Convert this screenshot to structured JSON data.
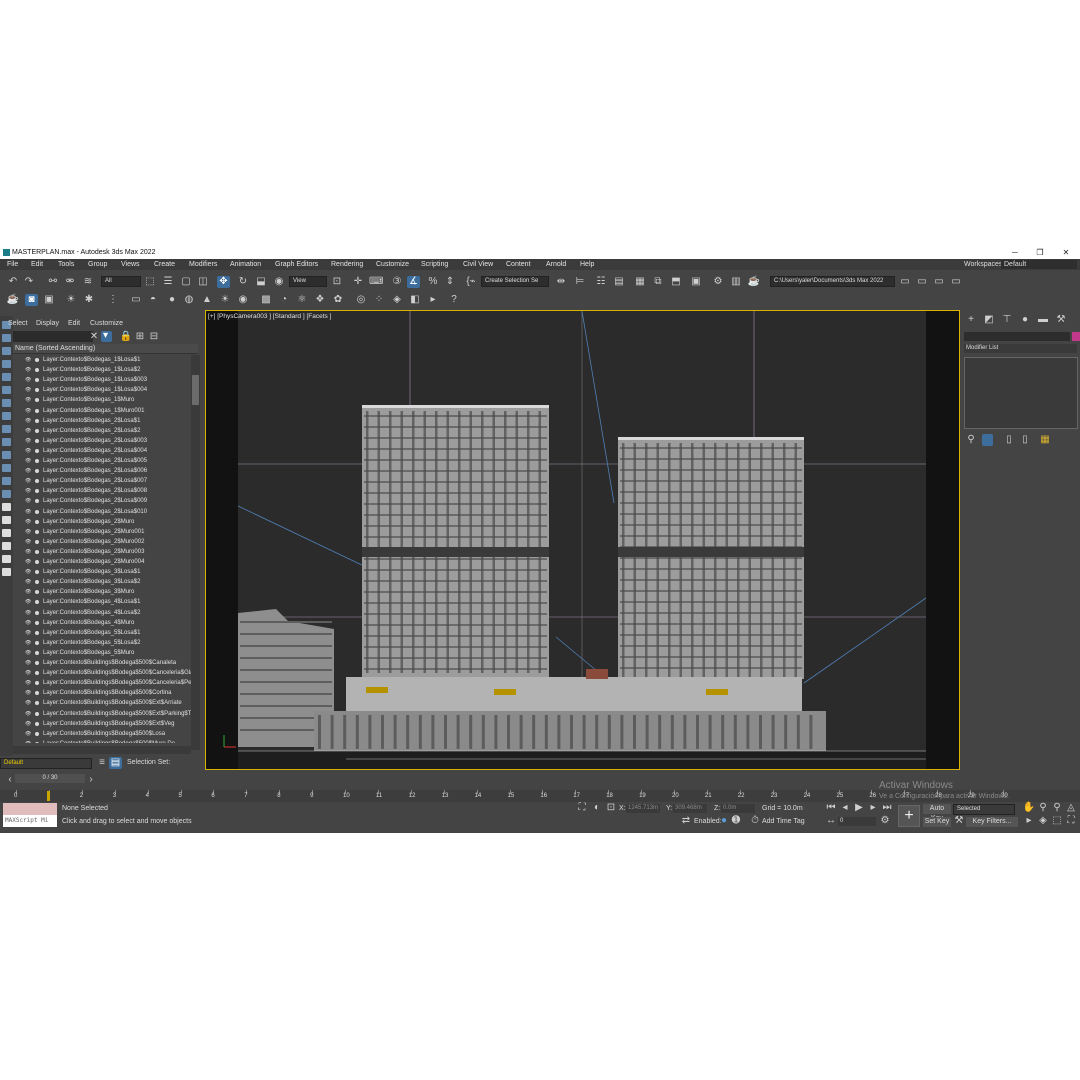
{
  "window": {
    "title": "MASTERPLAN.max - Autodesk 3ds Max 2022",
    "minimize": "─",
    "maximize": "❐",
    "close": "✕"
  },
  "menu": [
    "File",
    "Edit",
    "Tools",
    "Group",
    "Views",
    "Create",
    "Modifiers",
    "Animation",
    "Graph Editors",
    "Rendering",
    "Customize",
    "Scripting",
    "Civil View",
    "Content",
    "Arnold",
    "Help"
  ],
  "workspaces": {
    "label": "Workspaces:",
    "value": "Default"
  },
  "toolbar": {
    "filter": "All",
    "ref_coord": "View",
    "selection_set": "Create Selection Se",
    "project_path": "C:\\Users\\yaler\\Documents\\3ds Max 2022"
  },
  "scene_explorer": {
    "tabs": [
      "Select",
      "Display",
      "Edit",
      "Customize"
    ],
    "column_header": "Name (Sorted Ascending)",
    "rows": [
      "Layer:Contexto$Bodegas_1$Losa$1",
      "Layer:Contexto$Bodegas_1$Losa$2",
      "Layer:Contexto$Bodegas_1$Losa$003",
      "Layer:Contexto$Bodegas_1$Losa$004",
      "Layer:Contexto$Bodegas_1$Muro",
      "Layer:Contexto$Bodegas_1$Muro001",
      "Layer:Contexto$Bodegas_2$Losa$1",
      "Layer:Contexto$Bodegas_2$Losa$2",
      "Layer:Contexto$Bodegas_2$Losa$003",
      "Layer:Contexto$Bodegas_2$Losa$004",
      "Layer:Contexto$Bodegas_2$Losa$005",
      "Layer:Contexto$Bodegas_2$Losa$006",
      "Layer:Contexto$Bodegas_2$Losa$007",
      "Layer:Contexto$Bodegas_2$Losa$008",
      "Layer:Contexto$Bodegas_2$Losa$009",
      "Layer:Contexto$Bodegas_2$Losa$010",
      "Layer:Contexto$Bodegas_2$Muro",
      "Layer:Contexto$Bodegas_2$Muro001",
      "Layer:Contexto$Bodegas_2$Muro002",
      "Layer:Contexto$Bodegas_2$Muro003",
      "Layer:Contexto$Bodegas_2$Muro004",
      "Layer:Contexto$Bodegas_3$Losa$1",
      "Layer:Contexto$Bodegas_3$Losa$2",
      "Layer:Contexto$Bodegas_3$Muro",
      "Layer:Contexto$Bodegas_4$Losa$1",
      "Layer:Contexto$Bodegas_4$Losa$2",
      "Layer:Contexto$Bodegas_4$Muro",
      "Layer:Contexto$Bodegas_5$Losa$1",
      "Layer:Contexto$Bodegas_5$Losa$2",
      "Layer:Contexto$Bodegas_5$Muro",
      "Layer:Contexto$Buildings$Bodega$500$Canaleta",
      "Layer:Contexto$Buildings$Bodega$500$Canceleria$Gla",
      "Layer:Contexto$Buildings$Bodega$500$Canceleria$Per",
      "Layer:Contexto$Buildings$Bodega$500$Cortina",
      "Layer:Contexto$Buildings$Bodega$500$Ext$Arriate",
      "Layer:Contexto$Buildings$Bodega$500$Ext$Parking$T",
      "Layer:Contexto$Buildings$Bodega$500$Ext$Veg",
      "Layer:Contexto$Buildings$Bodega$500$Losa",
      "Layer:Contexto$Buildings$Bodega$500$Muro De"
    ],
    "layer": "Default",
    "selection_set_label": "Selection Set:"
  },
  "viewport": {
    "label": "[+] [PhysCamera003 ] [Standard ] [Facets ]"
  },
  "command_panel": {
    "modifier_list": "Modifier List"
  },
  "timeline": {
    "frame_counter": "0 / 30",
    "ticks": [
      "0",
      "1",
      "2",
      "3",
      "4",
      "5",
      "6",
      "7",
      "8",
      "9",
      "10",
      "11",
      "12",
      "13",
      "14",
      "15",
      "16",
      "17",
      "18",
      "19",
      "20",
      "21",
      "22",
      "23",
      "24",
      "25",
      "26",
      "27",
      "28",
      "29",
      "30"
    ]
  },
  "status": {
    "maxscript": "MAXScript Mi",
    "selection": "None Selected",
    "prompt": "Click and drag to select and move objects",
    "x_label": "X:",
    "x_value": "1245.713m",
    "y_label": "Y:",
    "y_value": "309.468m",
    "z_label": "Z:",
    "z_value": "0.0m",
    "grid": "Grid = 10.0m",
    "enabled": "Enabled:",
    "add_time_tag": "Add Time Tag",
    "auto_key": "Auto Key",
    "key_mode": "Selected",
    "set_key": "Set Key",
    "key_filters": "Key Filters...",
    "frame": "0"
  },
  "watermark": {
    "line1": "Activar Windows",
    "line2": "Ve a Configuración para activar Windows."
  }
}
